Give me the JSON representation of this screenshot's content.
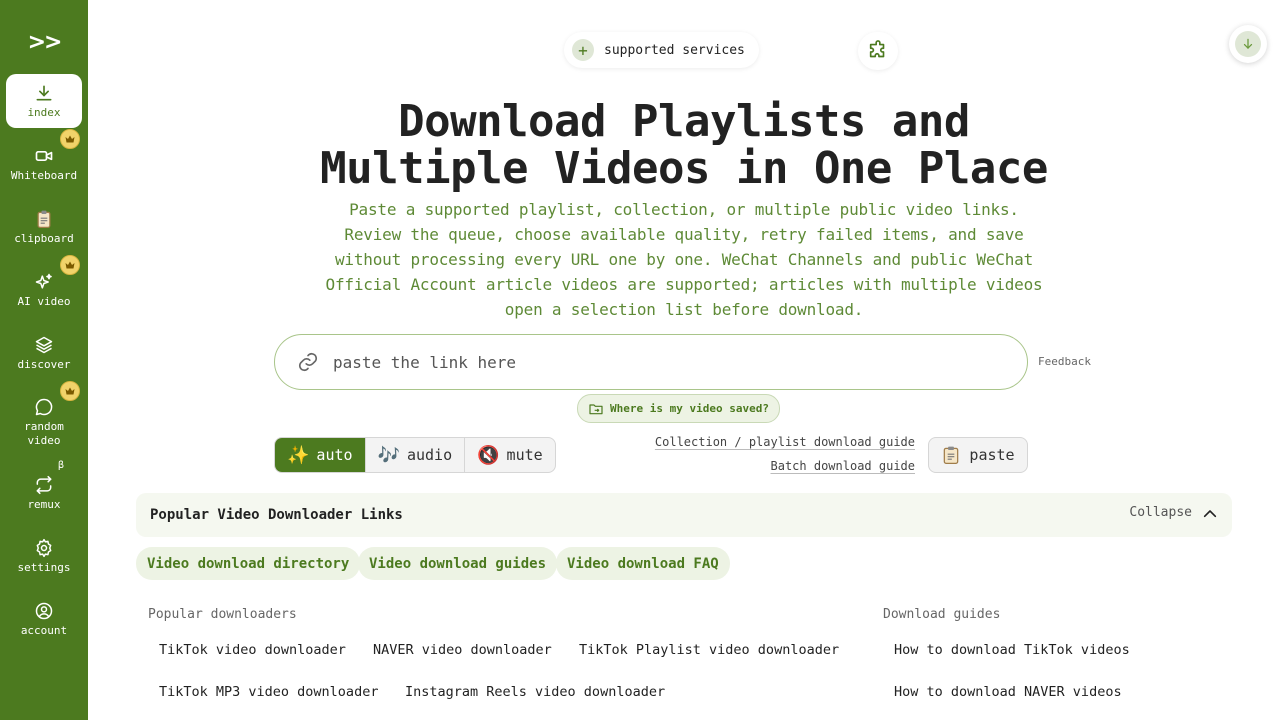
{
  "sidebar": {
    "logo": ">>",
    "items": [
      {
        "label": "index",
        "icon": "download-icon",
        "active": true
      },
      {
        "label": "Whiteboard",
        "icon": "video-camera-icon",
        "premium": true
      },
      {
        "label": "clipboard",
        "icon": "clipboard-icon"
      },
      {
        "label": "AI video",
        "icon": "sparkles-icon",
        "premium": true
      },
      {
        "label": "discover",
        "icon": "layers-icon"
      },
      {
        "label": "random video",
        "icon": "chat-bubble-icon",
        "premium": true
      },
      {
        "label": "remux",
        "icon": "repeat-icon",
        "badge": "β"
      },
      {
        "label": "settings",
        "icon": "gear-icon"
      },
      {
        "label": "account",
        "icon": "user-circle-icon"
      }
    ]
  },
  "top": {
    "services_label": "supported services",
    "services_icon": "plus-icon",
    "extension_icon": "puzzle-icon",
    "download_icon": "arrow-down-icon"
  },
  "hero": {
    "title_line1": "Download Playlists and",
    "title_line2": "Multiple Videos in One Place",
    "description": "Paste a supported playlist, collection, or multiple public video links. Review the queue, choose available quality, retry failed items, and save without processing every URL one by one. WeChat Channels and public WeChat Official Account article videos are supported; articles with multiple videos open a selection list before download."
  },
  "input": {
    "placeholder": "paste the link here",
    "value": "",
    "icon": "link-icon"
  },
  "feedback_label": "Feedback",
  "saved_label": "Where is my video saved?",
  "modes": [
    {
      "label": "auto",
      "emoji": "✨",
      "active": true
    },
    {
      "label": "audio",
      "emoji": "🎶"
    },
    {
      "label": "mute",
      "emoji": "🔇"
    }
  ],
  "guides": {
    "playlist": "Collection / playlist download guide",
    "batch": "Batch download guide"
  },
  "paste_label": "paste",
  "popular": {
    "title": "Popular Video Downloader Links",
    "collapse_label": "Collapse",
    "pills": [
      "Video download directory",
      "Video download guides",
      "Video download FAQ"
    ],
    "downloaders_heading": "Popular downloaders",
    "downloaders": [
      "TikTok video downloader",
      "NAVER video downloader",
      "TikTok Playlist video downloader",
      "TikTok MP3 video downloader",
      "Instagram Reels video downloader"
    ],
    "guides_heading": "Download guides",
    "guides": [
      "How to download TikTok videos",
      "How to download NAVER videos"
    ]
  },
  "colors": {
    "brand": "#4c7a1f",
    "accent_text": "#5e8a36",
    "crown": "#f1d36a"
  }
}
